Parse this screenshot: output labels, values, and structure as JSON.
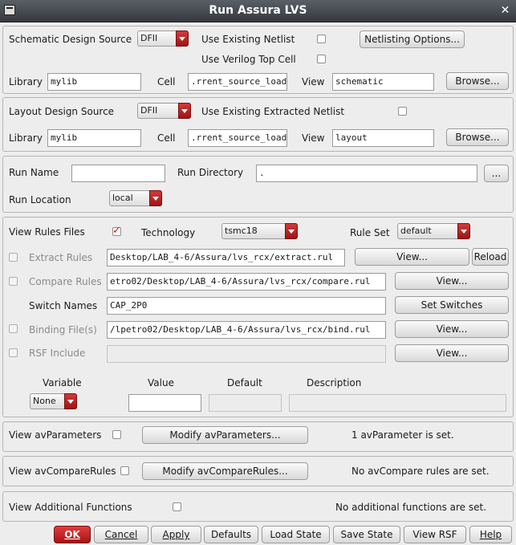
{
  "window": {
    "title": "Run Assura LVS"
  },
  "schematic": {
    "source_label": "Schematic Design Source",
    "source_value": "DFII",
    "use_netlist_label": "Use Existing Netlist",
    "use_verilog_label": "Use Verilog Top Cell",
    "netlisting_btn": "Netlisting Options...",
    "library_label": "Library",
    "library_value": "mylib",
    "cell_label": "Cell",
    "cell_value": ".rrent_source_load",
    "view_label": "View",
    "view_value": "schematic",
    "browse_btn": "Browse..."
  },
  "layout": {
    "source_label": "Layout Design Source",
    "source_value": "DFII",
    "use_extracted_label": "Use Existing Extracted Netlist",
    "library_label": "Library",
    "library_value": "mylib",
    "cell_label": "Cell",
    "cell_value": ".rrent_source_load",
    "view_label": "View",
    "view_value": "layout",
    "browse_btn": "Browse..."
  },
  "run": {
    "name_label": "Run Name",
    "name_value": "",
    "dir_label": "Run Directory",
    "dir_value": ".",
    "dir_btn": "...",
    "location_label": "Run Location",
    "location_value": "local"
  },
  "rules": {
    "view_rules_label": "View Rules Files",
    "technology_label": "Technology",
    "technology_value": "tsmc18",
    "ruleset_label": "Rule Set",
    "ruleset_value": "default",
    "extract_label": "Extract Rules",
    "extract_value": "Desktop/LAB_4-6/Assura/lvs_rcx/extract.rul",
    "extract_view_btn": "View...",
    "reload_btn": "Reload",
    "compare_label": "Compare Rules",
    "compare_value": "etro02/Desktop/LAB_4-6/Assura/lvs_rcx/compare.rul",
    "compare_view_btn": "View...",
    "switch_label": "Switch Names",
    "switch_value": "CAP_2P0",
    "switch_btn": "Set Switches",
    "binding_label": "Binding File(s)",
    "binding_value": "/lpetro02/Desktop/LAB_4-6/Assura/lvs_rcx/bind.rul",
    "binding_view_btn": "View...",
    "rsf_label": "RSF Include",
    "rsf_value": "",
    "rsf_view_btn": "View...",
    "var_header": "Variable",
    "value_header": "Value",
    "default_header": "Default",
    "desc_header": "Description",
    "var_value": "None"
  },
  "av_params": {
    "label": "View avParameters",
    "btn": "Modify avParameters...",
    "status": "1 avParameter is set."
  },
  "av_compare": {
    "label": "View avCompareRules",
    "btn": "Modify avCompareRules...",
    "status": "No avCompare rules are set."
  },
  "additional": {
    "label": "View Additional Functions",
    "status": "No additional functions are set."
  },
  "footer": {
    "ok": "OK",
    "cancel": "Cancel",
    "apply": "Apply",
    "defaults": "Defaults",
    "load_state": "Load State",
    "save_state": "Save State",
    "view_rsf": "View RSF",
    "help": "Help"
  },
  "colors": {
    "accent": "#b01818",
    "titlebar": "#3f444a"
  }
}
